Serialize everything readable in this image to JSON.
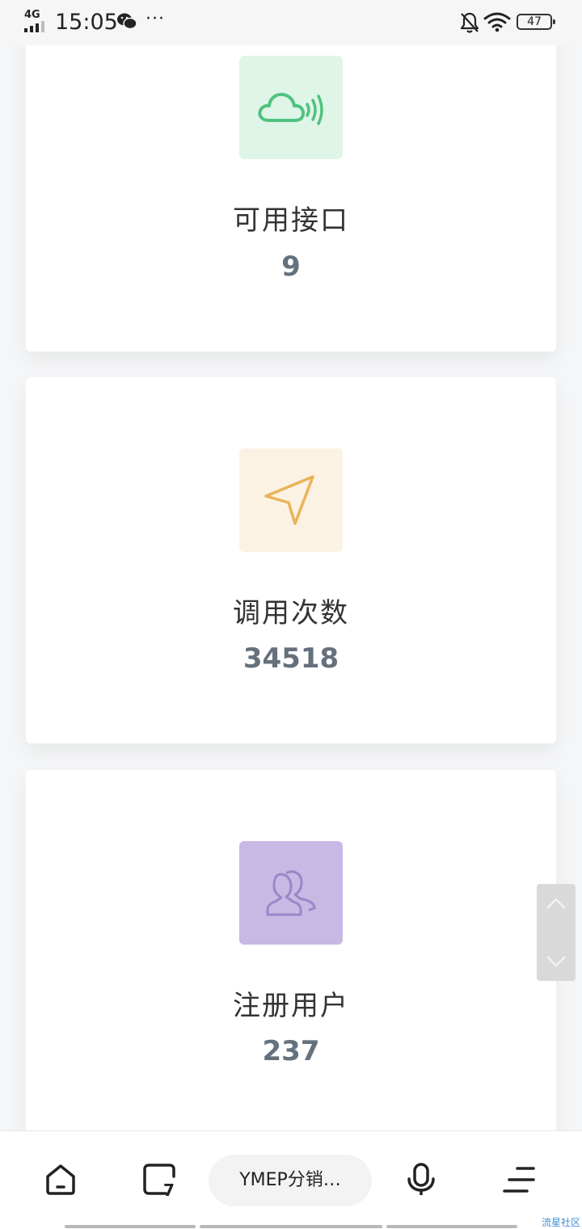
{
  "status_bar": {
    "network": "4G",
    "time": "15:05",
    "more": "···",
    "battery": "47"
  },
  "stats": [
    {
      "label": "可用接口",
      "value": "9",
      "icon": "cloud-signal-icon",
      "color": "#4fc27f"
    },
    {
      "label": "调用次数",
      "value": "34518",
      "icon": "send-arrow-icon",
      "color": "#e8b45a"
    },
    {
      "label": "注册用户",
      "value": "237",
      "icon": "users-icon",
      "color": "#9a86c8"
    }
  ],
  "toolbar": {
    "address": "YMEP分销…"
  },
  "watermark": "流星社区",
  "colors": {
    "value_text": "#65717c",
    "page_bg": "#f5f6f7"
  }
}
